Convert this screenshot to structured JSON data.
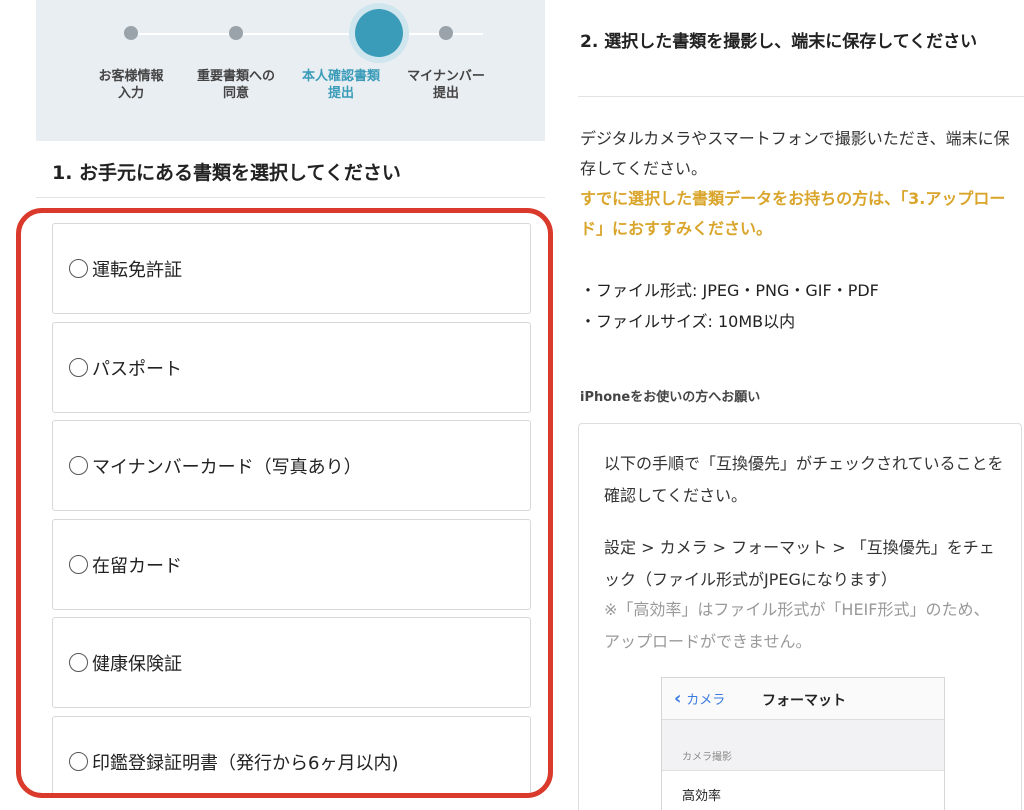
{
  "stepper": {
    "steps": [
      {
        "label": "お客様情報\n入力",
        "state": "done"
      },
      {
        "label": "重要書類への\n同意",
        "state": "done"
      },
      {
        "label": "本人確認書類\n提出",
        "state": "active"
      },
      {
        "label": "マイナンバー\n提出",
        "state": "todo"
      }
    ]
  },
  "section1": {
    "title": "1. お手元にある書類を選択してください",
    "options": [
      {
        "label": "運転免許証"
      },
      {
        "label": "パスポート"
      },
      {
        "label": "マイナンバーカード（写真あり）"
      },
      {
        "label": "在留カード"
      },
      {
        "label": "健康保険証"
      },
      {
        "label": "印鑑登録証明書（発行から6ヶ月以内)"
      }
    ]
  },
  "section2": {
    "title": "2. 選択した書類を撮影し、端末に保存してください",
    "description": "デジタルカメラやスマートフォンで撮影いただき、端末に保存してください。",
    "note": "すでに選択した書類データをお持ちの方は、「3.アップロード」におすすみください。",
    "spec_format": "・ファイル形式: JPEG・PNG・GIF・PDF",
    "spec_size": "・ファイルサイズ: 10MB以内",
    "iphone_label": "iPhoneをお使いの方へお願い",
    "iphone_text1": "以下の手順で「互換優先」がチェックされていることを確認してください。",
    "iphone_text2": "設定 > カメラ > フォーマット > 「互換優先」をチェック（ファイル形式がJPEGになります）",
    "iphone_text3": "※「高効率」はファイル形式が「HEIF形式」のため、アップロードができません。",
    "mock": {
      "back_label": "カメラ",
      "title": "フォーマット",
      "section_label": "カメラ撮影",
      "row_label": "高効率"
    }
  },
  "colors": {
    "accent": "#3a9cb8",
    "highlight_frame": "#d93a2b",
    "note": "#d9a52b"
  }
}
